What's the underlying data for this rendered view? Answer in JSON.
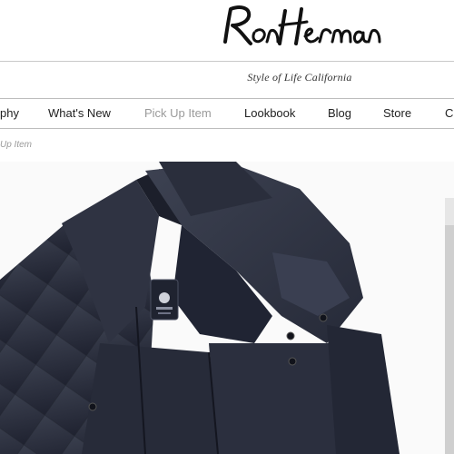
{
  "brand": {
    "logo_text": "Ron Herman"
  },
  "header": {
    "tagline": "Style of Life California"
  },
  "nav": {
    "items": [
      {
        "label": "phy",
        "active": false
      },
      {
        "label": "What's New",
        "active": false
      },
      {
        "label": "Pick Up Item",
        "active": true
      },
      {
        "label": "Lookbook",
        "active": false
      },
      {
        "label": "Blog",
        "active": false
      },
      {
        "label": "Store",
        "active": false
      },
      {
        "label": "C",
        "active": false
      }
    ]
  },
  "breadcrumb": {
    "current": "Up Item"
  },
  "product_image": {
    "label_text": ""
  },
  "colors": {
    "nav_active": "#9a9a9a",
    "jacket": "#2b2f3c",
    "background": "#ffffff"
  }
}
